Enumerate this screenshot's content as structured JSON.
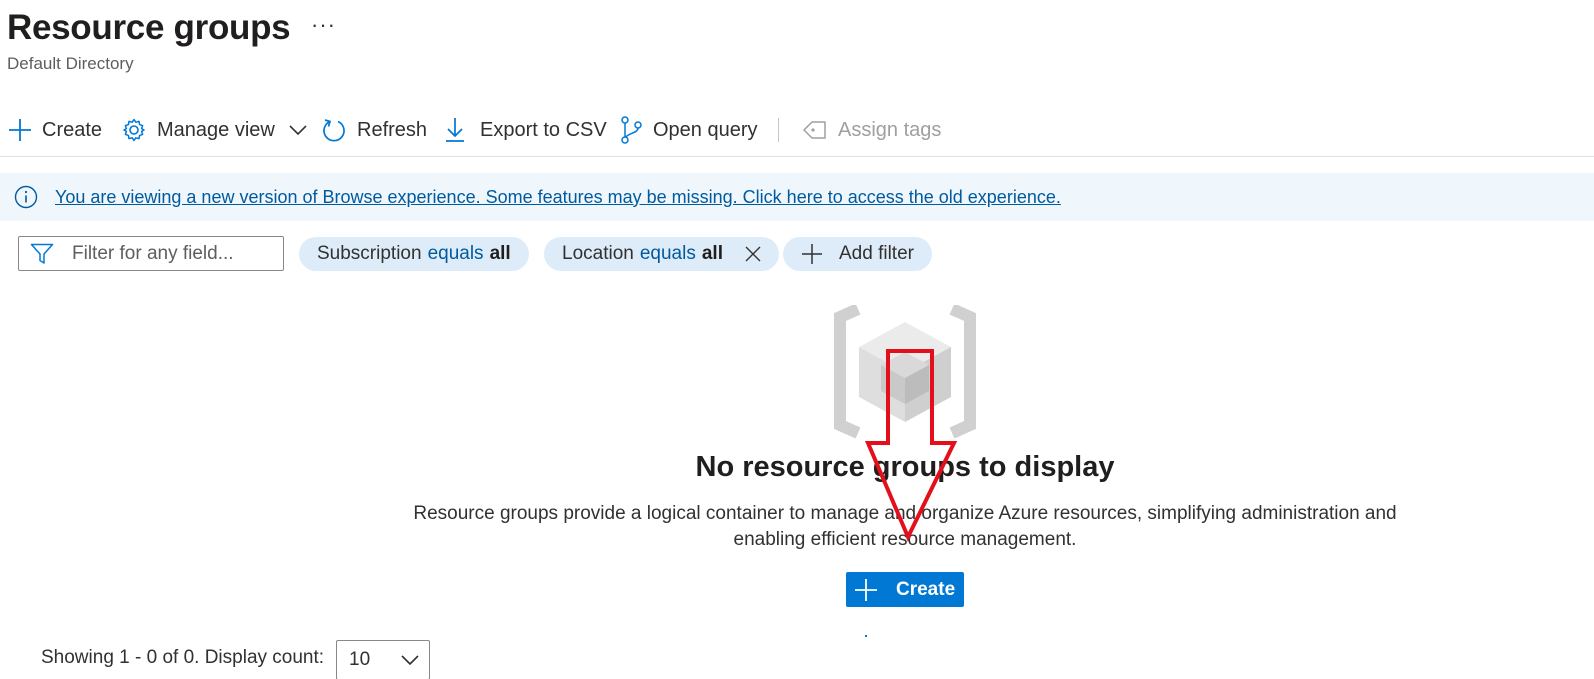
{
  "header": {
    "title": "Resource groups",
    "more": "···",
    "subtitle": "Default Directory"
  },
  "toolbar": {
    "create": "Create",
    "manage_view": "Manage view",
    "refresh": "Refresh",
    "export_csv": "Export to CSV",
    "open_query": "Open query",
    "assign_tags": "Assign tags"
  },
  "banner": {
    "text": "You are viewing a new version of Browse experience. Some features may be missing. Click here to access the old experience."
  },
  "filters": {
    "placeholder": "Filter for any field...",
    "pills": [
      {
        "field": "Subscription",
        "operator": "equals",
        "value": "all"
      },
      {
        "field": "Location",
        "operator": "equals",
        "value": "all"
      }
    ],
    "add_filter": "Add filter"
  },
  "empty_state": {
    "title": "No resource groups to display",
    "description": "Resource groups provide a logical container to manage and organize Azure resources, simplifying administration and enabling efficient resource management.",
    "create_label": "Create"
  },
  "footer": {
    "showing": "Showing 1 - 0 of 0. Display count:",
    "display_count": "10"
  },
  "colors": {
    "accent": "#0078d4",
    "link": "#005a9e",
    "banner_bg": "#eff6fc",
    "pill_bg": "#deecf9",
    "annotation_arrow": "#e3101c"
  }
}
